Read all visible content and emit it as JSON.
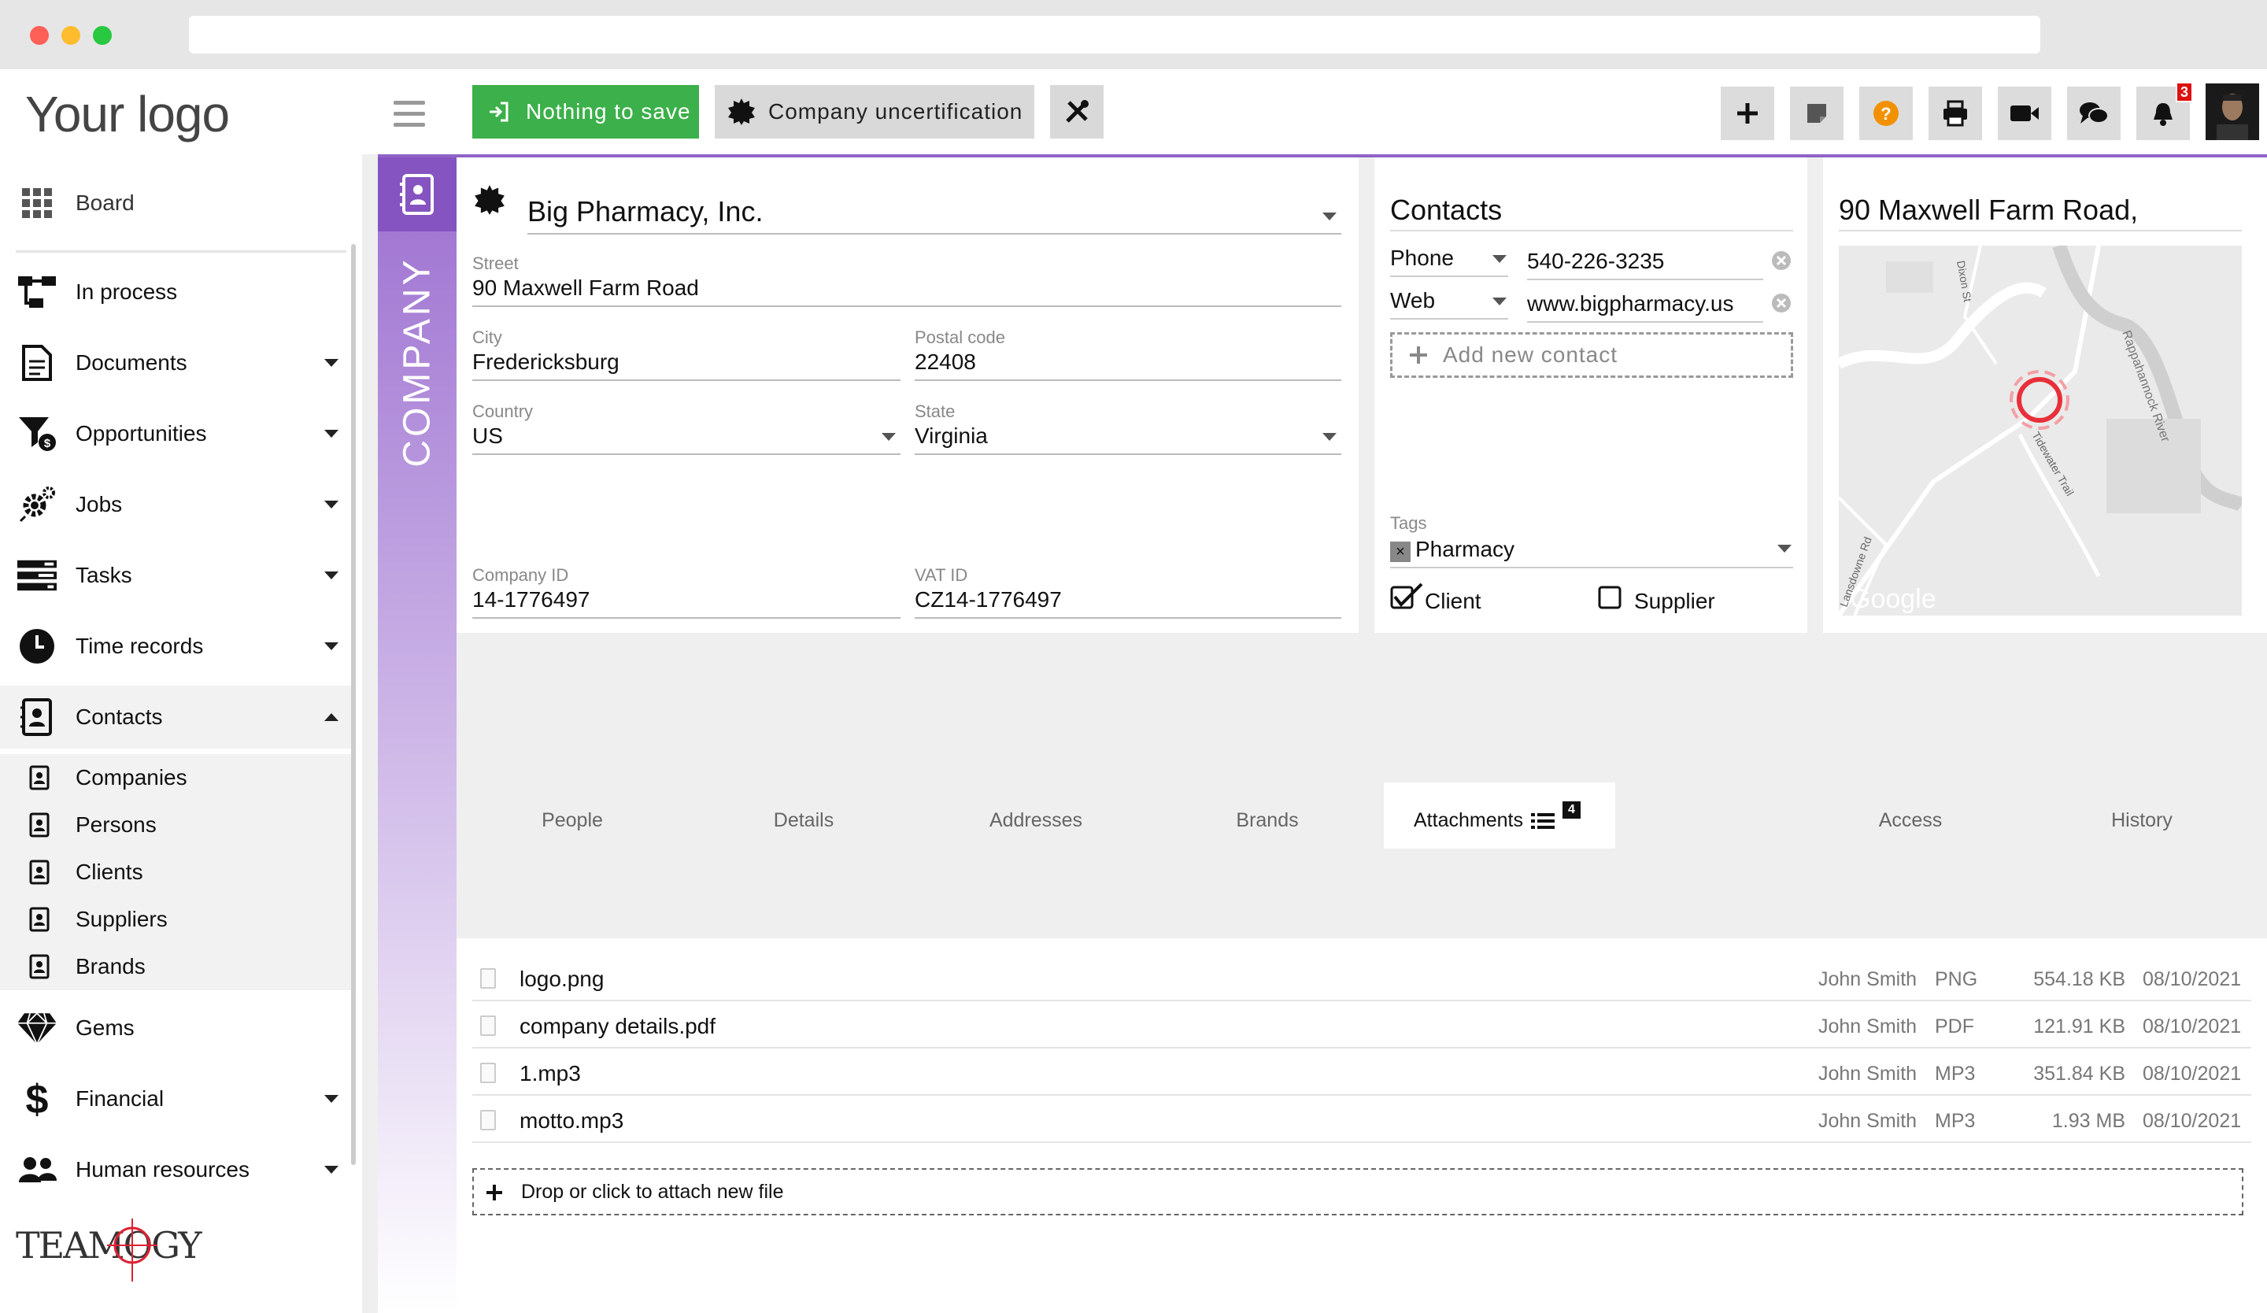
{
  "topbar": {
    "logo": "Your logo",
    "save_label": "Nothing to save",
    "uncert_label": "Company uncertification",
    "notifications_count": "3"
  },
  "sidebar": {
    "board": "Board",
    "in_process": "In process",
    "documents": "Documents",
    "opportunities": "Opportunities",
    "jobs": "Jobs",
    "tasks": "Tasks",
    "time_records": "Time records",
    "contacts": "Contacts",
    "sub": [
      "Companies",
      "Persons",
      "Clients",
      "Suppliers",
      "Brands"
    ],
    "gems": "Gems",
    "financial": "Financial",
    "human_resources": "Human resources"
  },
  "company": {
    "section_label": "COMPANY",
    "name": "Big Pharmacy, Inc.",
    "street_label": "Street",
    "street": "90  Maxwell Farm Road",
    "city_label": "City",
    "city": "Fredericksburg",
    "postal_label": "Postal code",
    "postal": "22408",
    "country_label": "Country",
    "country": "US",
    "state_label": "State",
    "state": "Virginia",
    "company_id_label": "Company ID",
    "company_id": "14-1776497",
    "vat_label": "VAT ID",
    "vat": "CZ14-1776497"
  },
  "contacts": {
    "title": "Contacts",
    "rows": [
      {
        "type": "Phone",
        "value": "540-226-3235"
      },
      {
        "type": "Web",
        "value": "www.bigpharmacy.us"
      }
    ],
    "add_label": "Add new contact",
    "tags_label": "Tags",
    "tag": "Pharmacy",
    "client_label": "Client",
    "supplier_label": "Supplier",
    "client_checked": true,
    "supplier_checked": false
  },
  "map": {
    "title": "90 Maxwell Farm Road,",
    "labels": [
      "Dixon St",
      "Rappahannock River",
      "Tidewater Trail",
      "Lansdowne Rd",
      "Google"
    ]
  },
  "tabs": [
    "People",
    "Details",
    "Addresses",
    "Brands",
    "Attachments",
    "Access",
    "History"
  ],
  "attachments_count": "4",
  "files": [
    {
      "name": "logo.png",
      "user": "John Smith",
      "type": "PNG",
      "size": "554.18 KB",
      "date": "08/10/2021"
    },
    {
      "name": "company details.pdf",
      "user": "John Smith",
      "type": "PDF",
      "size": "121.91 KB",
      "date": "08/10/2021"
    },
    {
      "name": "1.mp3",
      "user": "John Smith",
      "type": "MP3",
      "size": "351.84 KB",
      "date": "08/10/2021"
    },
    {
      "name": "motto.mp3",
      "user": "John Smith",
      "type": "MP3",
      "size": "1.93 MB",
      "date": "08/10/2021"
    }
  ],
  "dropzone_label": "Drop or click to attach new file",
  "brand": "TEAMOGY"
}
